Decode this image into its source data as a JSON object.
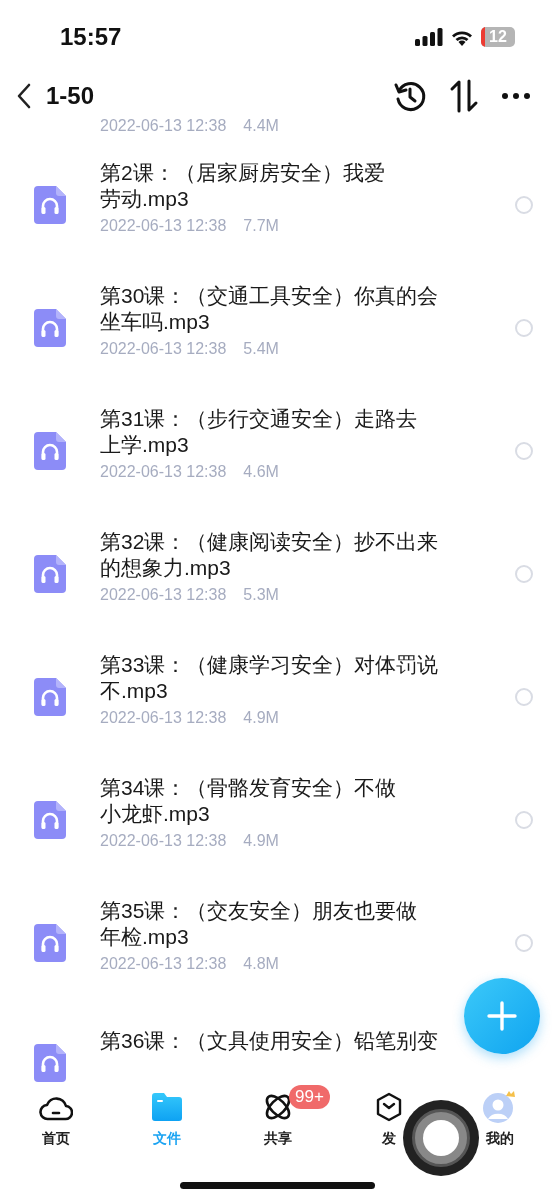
{
  "status_bar": {
    "time": "15:57",
    "battery": "12"
  },
  "nav": {
    "title": "1-50"
  },
  "files": [
    {
      "kind": "partial",
      "date": "2022-06-13 12:38",
      "size": "4.4M"
    },
    {
      "kind": "file",
      "title_lines": [
        "第2课：（居家厨房安全）我爱",
        "劳动.mp3"
      ],
      "date": "2022-06-13 12:38",
      "size": "7.7M",
      "selected": false
    },
    {
      "kind": "file",
      "title_lines": [
        "第30课：（交通工具安全）你真的会",
        "坐车吗.mp3"
      ],
      "date": "2022-06-13 12:38",
      "size": "5.4M",
      "selected": false
    },
    {
      "kind": "file",
      "title_lines": [
        "第31课：（步行交通安全）走路去",
        "上学.mp3"
      ],
      "date": "2022-06-13 12:38",
      "size": "4.6M",
      "selected": false
    },
    {
      "kind": "file",
      "title_lines": [
        "第32课：（健康阅读安全）抄不出来",
        "的想象力.mp3"
      ],
      "date": "2022-06-13 12:38",
      "size": "5.3M",
      "selected": false
    },
    {
      "kind": "file",
      "title_lines": [
        "第33课：（健康学习安全）对体罚说",
        "不.mp3"
      ],
      "date": "2022-06-13 12:38",
      "size": "4.9M",
      "selected": false
    },
    {
      "kind": "file",
      "title_lines": [
        "第34课：（骨骼发育安全）不做",
        "小龙虾.mp3"
      ],
      "date": "2022-06-13 12:38",
      "size": "4.9M",
      "selected": false
    },
    {
      "kind": "file",
      "title_lines": [
        "第35课：（交友安全）朋友也要做",
        "年检.mp3"
      ],
      "date": "2022-06-13 12:38",
      "size": "4.8M",
      "selected": false
    },
    {
      "kind": "cut",
      "title_lines": [
        "第36课：（文具使用安全）铅笔别变"
      ]
    }
  ],
  "tabs": [
    {
      "kind": "home",
      "label": "首页",
      "selected": false
    },
    {
      "kind": "files",
      "label": "文件",
      "selected": true
    },
    {
      "kind": "share",
      "label": "共享",
      "selected": false,
      "badge": "99+"
    },
    {
      "kind": "discover",
      "label": "发",
      "selected": false
    },
    {
      "kind": "me",
      "label": "我的",
      "selected": false
    }
  ]
}
